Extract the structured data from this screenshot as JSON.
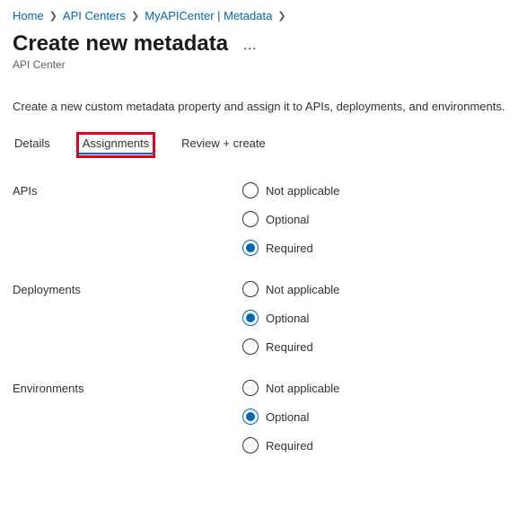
{
  "breadcrumb": {
    "items": [
      {
        "label": "Home"
      },
      {
        "label": "API Centers"
      },
      {
        "label": "MyAPICenter | Metadata"
      }
    ]
  },
  "header": {
    "title": "Create new metadata",
    "subtitle": "API Center"
  },
  "description": "Create a new custom metadata property and assign it to APIs, deployments, and environments.",
  "tabs": [
    {
      "label": "Details",
      "active": false
    },
    {
      "label": "Assignments",
      "active": true,
      "highlighted": true
    },
    {
      "label": "Review + create",
      "active": false
    }
  ],
  "assignments": [
    {
      "label": "APIs",
      "options": [
        {
          "label": "Not applicable",
          "selected": false
        },
        {
          "label": "Optional",
          "selected": false
        },
        {
          "label": "Required",
          "selected": true
        }
      ]
    },
    {
      "label": "Deployments",
      "options": [
        {
          "label": "Not applicable",
          "selected": false
        },
        {
          "label": "Optional",
          "selected": true
        },
        {
          "label": "Required",
          "selected": false
        }
      ]
    },
    {
      "label": "Environments",
      "options": [
        {
          "label": "Not applicable",
          "selected": false
        },
        {
          "label": "Optional",
          "selected": true
        },
        {
          "label": "Required",
          "selected": false
        }
      ]
    }
  ]
}
